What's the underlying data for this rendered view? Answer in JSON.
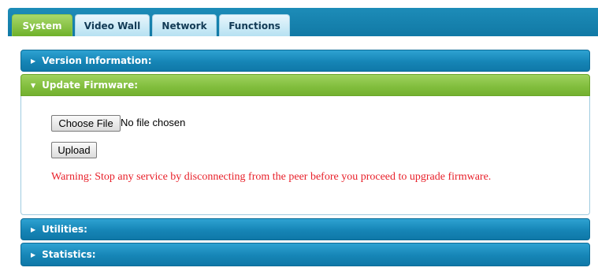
{
  "tabs": [
    {
      "label": "System",
      "active": true
    },
    {
      "label": "Video Wall",
      "active": false
    },
    {
      "label": "Network",
      "active": false
    },
    {
      "label": "Functions",
      "active": false
    }
  ],
  "panels": {
    "version_info": {
      "label": "Version Information:",
      "expanded": false
    },
    "update_firmware": {
      "label": "Update Firmware:",
      "expanded": true,
      "choose_file_label": "Choose File",
      "file_status": "No file chosen",
      "upload_label": "Upload",
      "warning": "Warning: Stop any service by disconnecting from the peer before you proceed to upgrade firmware."
    },
    "utilities": {
      "label": "Utilities:",
      "expanded": false
    },
    "statistics": {
      "label": "Statistics:",
      "expanded": false
    }
  },
  "colors": {
    "tabbar": "#1684b4",
    "active_tab": "#7fbb3c",
    "panel_blue": "#1a8abb",
    "panel_green": "#86c143",
    "warning_text": "#e8202a"
  },
  "icons": {
    "collapsed": "triangle-right",
    "expanded": "triangle-down"
  }
}
